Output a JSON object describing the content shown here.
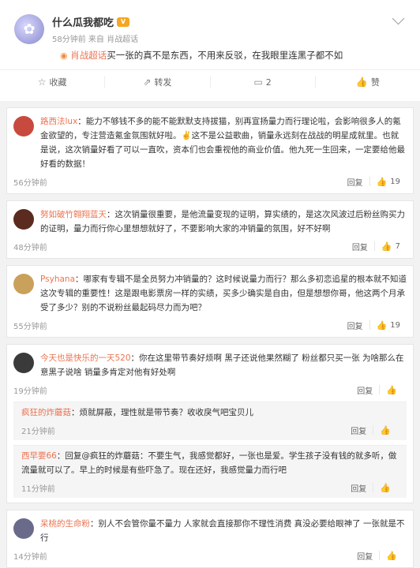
{
  "post": {
    "author": "什么瓜我都吃",
    "meta": "58分钟前 来自 肖战超话",
    "topic": "肖战超话",
    "text": "买一张的真不是东西，不用来反驳，在我眼里连黑子都不如",
    "actions": {
      "collect": "收藏",
      "repost": "转发",
      "comment": "2",
      "like": "赞"
    }
  },
  "comments": [
    {
      "name": "路西法lux",
      "text": "：能力不够钱不多的能不能默默支持拔猫，别再宣扬量力而行理论啦，会影响很多人的氪金欲望的，专注营造氪金氛围就好啦。✌️这不是公益歌曲，销量永远刻在战战的明星成就里。也就是说，这次销量好看了可以一直吹，资本们也会重视他的商业价值。他九死一生回来，一定要给他最好看的数据！",
      "time": "56分钟前",
      "reply": "回复",
      "likes": "19",
      "avatar_color": "#c84a3f"
    },
    {
      "name": "努如破竹翱翔蓝天",
      "text": "：这次销量很重要，是他流量变现的证明，算实绩的，是这次风波过后粉丝购买力的证明，量力而行你心里想想就好了，不要影响大家的冲销量的氛围，好不好啊",
      "time": "48分钟前",
      "reply": "回复",
      "likes": "7",
      "avatar_color": "#5a2b1e"
    },
    {
      "name": "Psyhana",
      "text": "：哪家有专辑不是全员努力冲销量的？这时候说量力而行？那么多初恋追星的根本就不知道这次专辑的重要性！这是跟电影票房一样的实绩，买多少确实是自由，但是想想你哥，他这两个月承受了多少？别的不说粉丝最起码尽力而为吧？",
      "time": "55分钟前",
      "reply": "回复",
      "likes": "19",
      "avatar_color": "#c9a15a"
    },
    {
      "name": "今天也是快乐的一天520",
      "text": "：你在这里带节奏好烦啊 黑子还说他果然糊了 粉丝都只买一张 为啥那么在意黑子说啥 销量多肯定对他有好处啊",
      "time": "19分钟前",
      "reply": "回复",
      "likes": "",
      "avatar_color": "#3a3a3a",
      "replies": [
        {
          "name": "疯狂的炸蘑菇",
          "text": "：烦就屏蔽，理性就是带节奏？收收戾气吧宝贝儿",
          "time": "21分钟前",
          "reply": "回复"
        },
        {
          "name": "西早要66",
          "text": "：回复@疯狂的炸蘑菇：不要生气，我感觉都好，一张也是爱。学生孩子没有钱的就多听，做流量就可以了。早上的时候是有些吓急了。现在还好，我感觉量力而行吧",
          "time": "11分钟前",
          "reply": "回复"
        }
      ]
    },
    {
      "name": "呆桃的生命粉",
      "text": "：别人不会管你量不量力 人家就会直接那你不理性消费 真没必要给眼神了 一张就是不行",
      "time": "14分钟前",
      "reply": "回复",
      "likes": "",
      "avatar_color": "#6a6a8a"
    }
  ]
}
